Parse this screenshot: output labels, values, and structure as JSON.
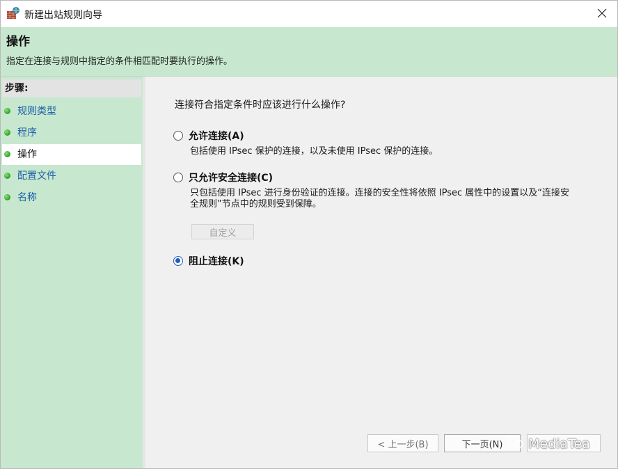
{
  "window": {
    "title": "新建出站规则向导",
    "close_icon": "close-icon"
  },
  "header": {
    "title": "操作",
    "description": "指定在连接与规则中指定的条件相匹配时要执行的操作。"
  },
  "steps": {
    "label": "步骤:",
    "items": [
      {
        "label": "规则类型",
        "current": false
      },
      {
        "label": "程序",
        "current": false
      },
      {
        "label": "操作",
        "current": true
      },
      {
        "label": "配置文件",
        "current": false
      },
      {
        "label": "名称",
        "current": false
      }
    ]
  },
  "main": {
    "question": "连接符合指定条件时应该进行什么操作?",
    "options": [
      {
        "label": "允许连接(A)",
        "description": "包括使用 IPsec 保护的连接，以及未使用 IPsec 保护的连接。",
        "checked": false
      },
      {
        "label": "只允许安全连接(C)",
        "description": "只包括使用 IPsec 进行身份验证的连接。连接的安全性将依照 IPsec 属性中的设置以及“连接安全规则”节点中的规则受到保障。",
        "checked": false
      },
      {
        "label": "阻止连接(K)",
        "description": "",
        "checked": true
      }
    ],
    "custom_button": "自定义"
  },
  "footer": {
    "back": "< 上一步(B)",
    "next": "下一页(N)",
    "watermark": "MediaTea"
  },
  "colors": {
    "header_bg": "#c7e8cf",
    "link_blue": "#1b5fa8",
    "radio_checked": "#1f5fb8"
  }
}
